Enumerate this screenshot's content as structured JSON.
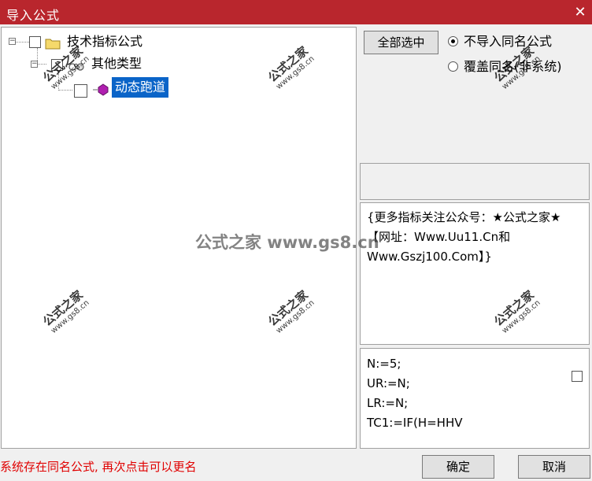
{
  "window": {
    "title": "导入公式",
    "close_glyph": "✕"
  },
  "tree": {
    "root": {
      "label": "技术指标公式",
      "expander": "−"
    },
    "group": {
      "label": "其他类型",
      "expander": "−"
    },
    "item": {
      "label": "动态跑道"
    }
  },
  "options": {
    "select_all_label": "全部选中",
    "radio_skip_label": "不导入同名公式",
    "radio_overwrite_label": "覆盖同名(非系统)",
    "selected_radio": "skip"
  },
  "description": {
    "text": "{更多指标关注公众号：★公式之家★ 【网址：Www.Uu11.Cn和Www.Gszj100.Com】}"
  },
  "code": {
    "lines": [
      "N:=5;",
      "UR:=N;",
      "LR:=N;",
      "TC1:=IF(H=HHV"
    ]
  },
  "status": {
    "message": "系统存在同名公式, 再次点击可以更名"
  },
  "buttons": {
    "ok_label": "确定",
    "cancel_label": "取消"
  },
  "watermark": {
    "center_text": "公式之家 www.gs8.cn",
    "stamp_title": "公式之家",
    "stamp_url": "www.gs8.cn"
  },
  "colors": {
    "titlebar": "#b9262d",
    "selection": "#0a64c8",
    "status_text": "#e00000"
  }
}
